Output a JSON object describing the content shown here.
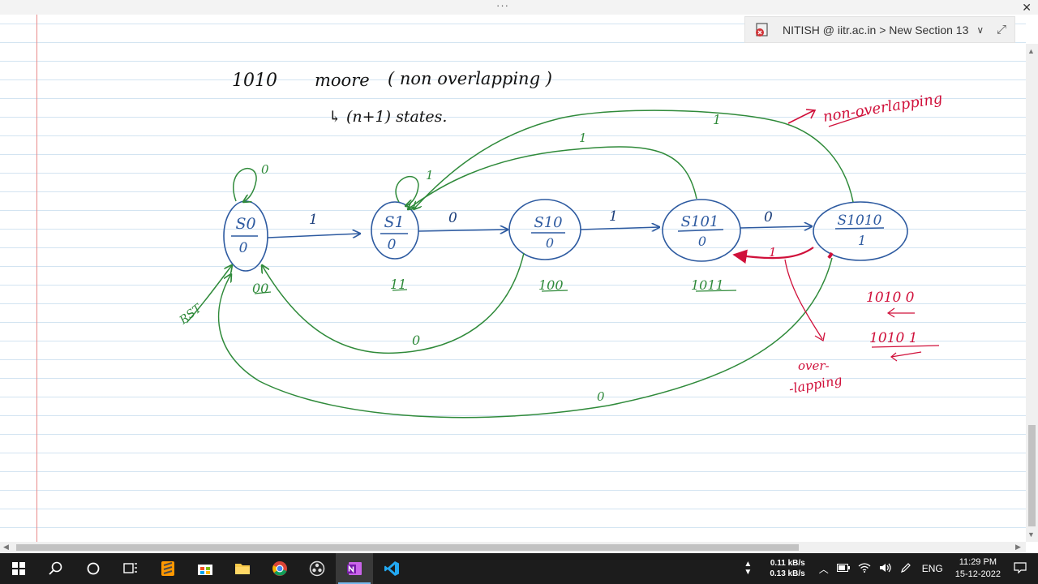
{
  "window": {
    "menu_dots": "···",
    "close_glyph": "✕"
  },
  "notebook": {
    "location": "NITISH @ iitr.ac.in > New Section 13",
    "chevron": "∨",
    "expand_glyph": "⤢"
  },
  "note": {
    "heading_sequence": "1010",
    "heading_type": "moore",
    "heading_mode": "( non overlapping )",
    "subnote": "↳ (n+1) states.",
    "annot_non_overlapping": "non-overlapping",
    "annot_over": "over-",
    "annot_lapping": "-lapping",
    "rst_label": "RST",
    "states": [
      {
        "name": "S0",
        "output": "0",
        "code": "00"
      },
      {
        "name": "S1",
        "output": "0",
        "code": "11"
      },
      {
        "name": "S10",
        "output": "0",
        "code": "100"
      },
      {
        "name": "S101",
        "output": "0",
        "code": "1011"
      },
      {
        "name": "S1010",
        "output": "1",
        "code": ""
      }
    ],
    "transition_labels": {
      "s0_self": "0",
      "s0_to_s1": "1",
      "s1_self": "1",
      "s1_to_s10": "0",
      "s10_to_s101": "1",
      "s101_to_s1010": "0",
      "s101_to_s1": "1",
      "s1010_to_s1": "1",
      "s10_to_s0": "0",
      "s1010_to_s0": "0",
      "s1010_to_s101_red": "1"
    },
    "side_seq_1": "1010 0",
    "side_seq_2": "1010 1"
  },
  "colors": {
    "blue_ink": "#2d5aa0",
    "green_ink": "#2f8a3a",
    "red_ink": "#d0103a",
    "rule_line": "#afcde6"
  },
  "taskbar": {
    "apps": [
      "start-icon",
      "search-icon",
      "cortana-icon",
      "task-view-icon",
      "sublime-icon",
      "store-icon",
      "file-explorer-icon",
      "chrome-icon",
      "obs-icon",
      "onenote-icon",
      "vscode-icon"
    ],
    "net_up": "0.11 kB/s",
    "net_down": "0.13 kB/s",
    "language": "ENG",
    "time": "11:29 PM",
    "date": "15-12-2022"
  }
}
